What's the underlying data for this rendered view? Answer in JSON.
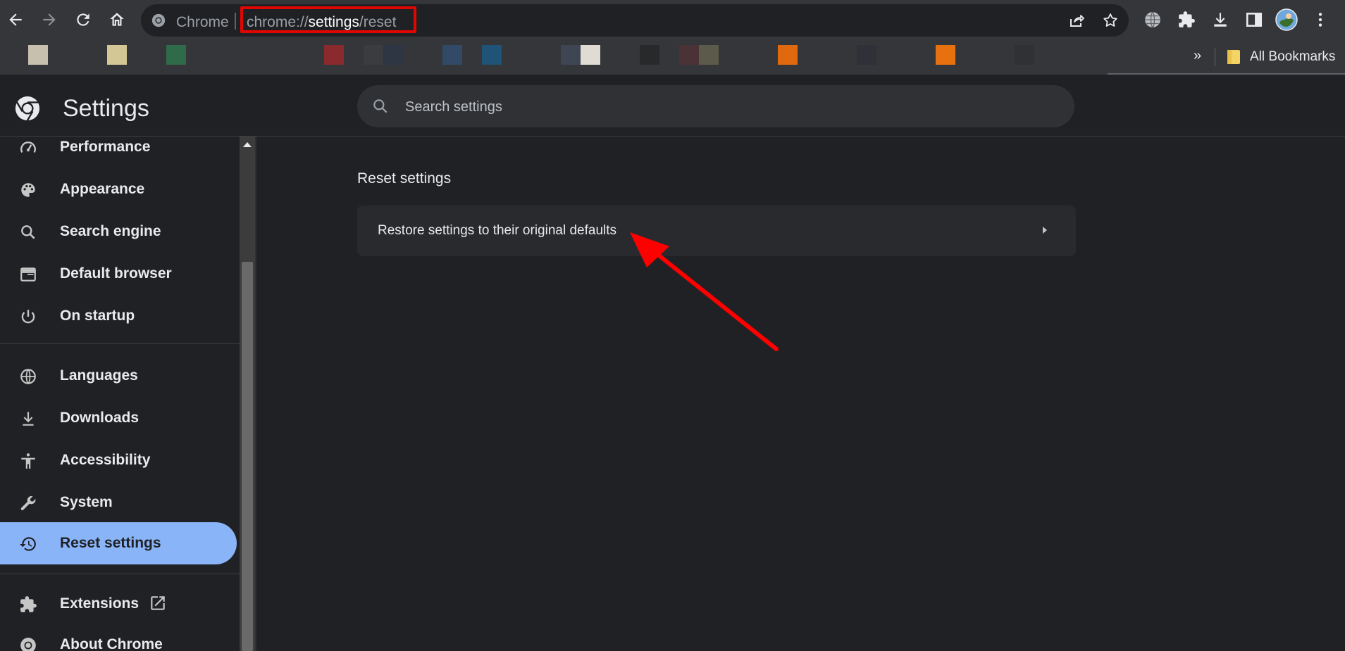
{
  "toolbar": {
    "back_icon": "arrow-left-icon",
    "forward_icon": "arrow-right-icon",
    "reload_icon": "reload-icon",
    "home_icon": "home-icon",
    "site_label": "Chrome",
    "url_prefix": "chrome://",
    "url_host": "settings",
    "url_path": "/reset",
    "right_icons": [
      "share-icon",
      "star-icon",
      "globe-icon",
      "extensions-puzzle-icon",
      "download-icon",
      "side-panel-icon",
      "avatar",
      "more-vert-icon"
    ]
  },
  "bookmarks_bar": {
    "favicon_colors": [
      "#c8c0ae",
      "#d3c796",
      "#2f6b48",
      "#8b2a2c",
      "#3a3c40",
      "#2e3644",
      "#324a67",
      "#1f5378",
      "#3e4654",
      "#e0dcd3",
      "#27292a",
      "#4a3236",
      "#5c5a4a",
      "#e0690f",
      "#2f3038",
      "#e8710f",
      "#303134"
    ],
    "overflow_label": "»",
    "all_bookmarks_label": "All Bookmarks"
  },
  "settings_header": {
    "title": "Settings",
    "search_placeholder": "Search settings"
  },
  "sidebar": {
    "items": [
      {
        "label": "Performance",
        "icon": "speedometer-icon"
      },
      {
        "label": "Appearance",
        "icon": "palette-icon"
      },
      {
        "label": "Search engine",
        "icon": "search-icon"
      },
      {
        "label": "Default browser",
        "icon": "browser-window-icon"
      },
      {
        "label": "On startup",
        "icon": "power-icon"
      },
      {
        "label": "Languages",
        "icon": "globe-icon"
      },
      {
        "label": "Downloads",
        "icon": "download-icon"
      },
      {
        "label": "Accessibility",
        "icon": "accessibility-icon"
      },
      {
        "label": "System",
        "icon": "wrench-icon"
      },
      {
        "label": "Reset settings",
        "icon": "history-restore-icon",
        "active": true
      },
      {
        "label": "Extensions",
        "icon": "extensions-puzzle-icon",
        "trailing_icon": "open-in-new-icon"
      },
      {
        "label": "About Chrome",
        "icon": "chrome-logo-icon"
      }
    ]
  },
  "main": {
    "section_heading": "Reset settings",
    "restore_row_label": "Restore settings to their original defaults",
    "restore_row_icon": "arrow-right-icon"
  },
  "colors": {
    "background": "#202124",
    "toolbar": "#35363a",
    "active_nav": "#8ab4f8",
    "highlight_red": "#e10600"
  }
}
